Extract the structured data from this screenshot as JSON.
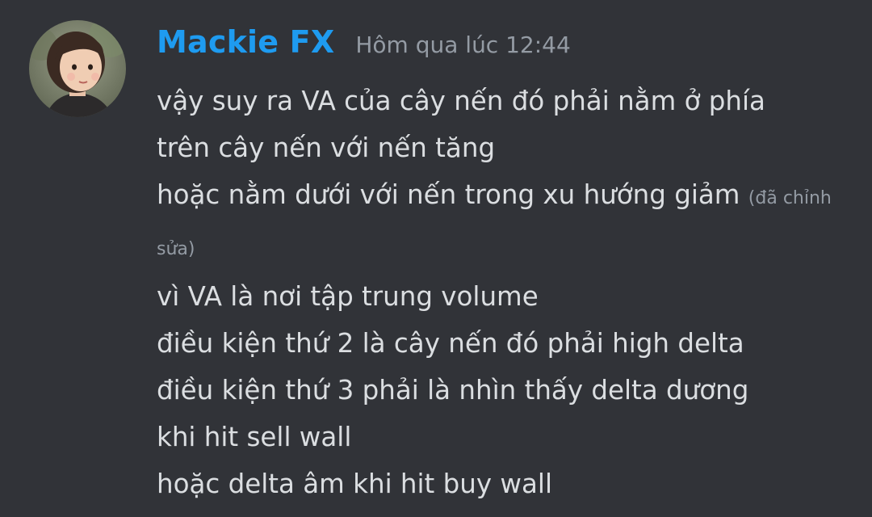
{
  "message": {
    "author": "Mackie FX",
    "timestamp": "Hôm qua lúc 12:44",
    "author_color": "#1e9bf0",
    "background": "#313338",
    "lines": [
      "vậy suy ra VA của cây nến đó phải nằm ở phía",
      "trên cây nến với nến tăng",
      "hoặc nằm dưới với nến trong xu hướng giảm",
      "vì VA là nơi tập trung volume",
      "điều kiện thứ 2 là cây nến đó phải high delta",
      "điều kiện thứ 3 phải là nhìn thấy delta dương",
      "khi hit sell wall",
      "hoặc delta âm khi hit buy wall"
    ],
    "edited_label": "(đã chỉnh sửa)"
  },
  "icons": {
    "avatar": "user-avatar-photo"
  }
}
